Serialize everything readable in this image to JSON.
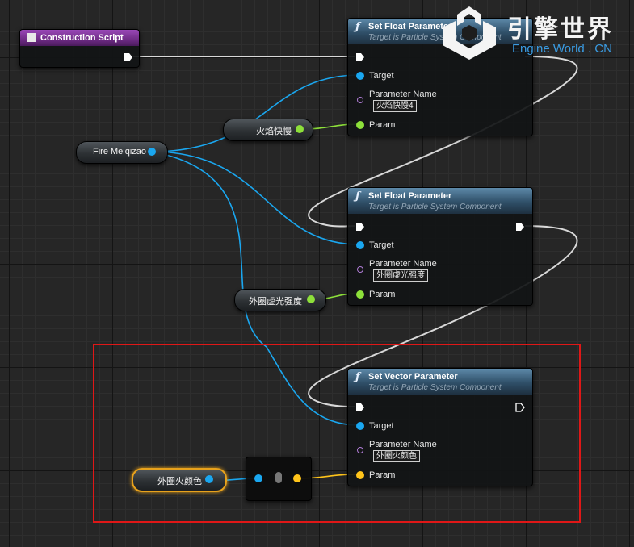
{
  "canvas": {
    "grid_color": "#141414",
    "background": "#262626"
  },
  "colors": {
    "object_pin": "#1aa7f0",
    "float_pin": "#8de03a",
    "vector_pin": "#ffc41a",
    "exec_wire": "#d8d8d8",
    "highlight_box": "#e01717",
    "construction_header": "#6f2c86"
  },
  "construction_script": {
    "title": "Construction Script",
    "icon": "construction-script-icon"
  },
  "watermark": {
    "logo_text": "引擎世界",
    "subtitle": "Engine World . CN"
  },
  "nodes": {
    "set_float_1": {
      "icon": "function-icon",
      "title": "Set Float Parameter",
      "subtitle": "Target is Particle System Component",
      "target_label": "Target",
      "param_name_label": "Parameter Name",
      "param_name_value": "火焰快慢4",
      "param_label": "Param"
    },
    "set_float_2": {
      "icon": "function-icon",
      "title": "Set Float Parameter",
      "subtitle": "Target is Particle System Component",
      "target_label": "Target",
      "param_name_label": "Parameter Name",
      "param_name_value": "外圈虚光强度",
      "param_label": "Param"
    },
    "set_vector": {
      "icon": "function-icon",
      "title": "Set Vector Parameter",
      "subtitle": "Target is Particle System Component",
      "target_label": "Target",
      "param_name_label": "Parameter Name",
      "param_name_value": "外圈火颜色",
      "param_label": "Param"
    }
  },
  "variables": {
    "fire": "Fire Meiqizao",
    "speed": "火焰快慢",
    "glow": "外圈虚光强度",
    "color": "外圈火颜色"
  }
}
